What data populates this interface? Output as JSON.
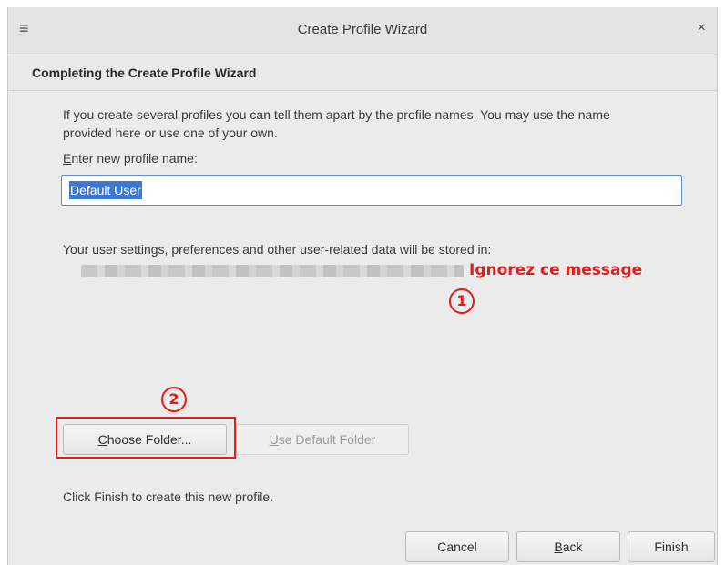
{
  "window": {
    "title": "Create Profile Wizard",
    "menu_icon": "hamburger-menu-icon",
    "close_icon": "close-icon",
    "close_glyph": "×",
    "menu_glyph": "≡"
  },
  "page": {
    "header": "Completing the Create Profile Wizard",
    "intro": "If you create several profiles you can tell them apart by the profile names. You may use the name provided here or use one of your own.",
    "field_label_first": "E",
    "field_label_rest": "nter new profile name:",
    "profile_name_value": "Default User",
    "stored_label": "Your user settings, preferences and other user-related data will be stored in:",
    "annotation_note": "Ignorez ce message",
    "marker_1": "1",
    "marker_2": "2",
    "finish_note": "Click Finish to create this new profile."
  },
  "buttons": {
    "choose_first": "C",
    "choose_rest": "hoose Folder...",
    "default_first": "U",
    "default_rest": "se Default Folder",
    "cancel": "Cancel",
    "back_first": "B",
    "back_rest": "ack",
    "finish": "Finish"
  },
  "colors": {
    "annotation_red": "#e51a1a",
    "selection_blue": "#3b78d3"
  }
}
